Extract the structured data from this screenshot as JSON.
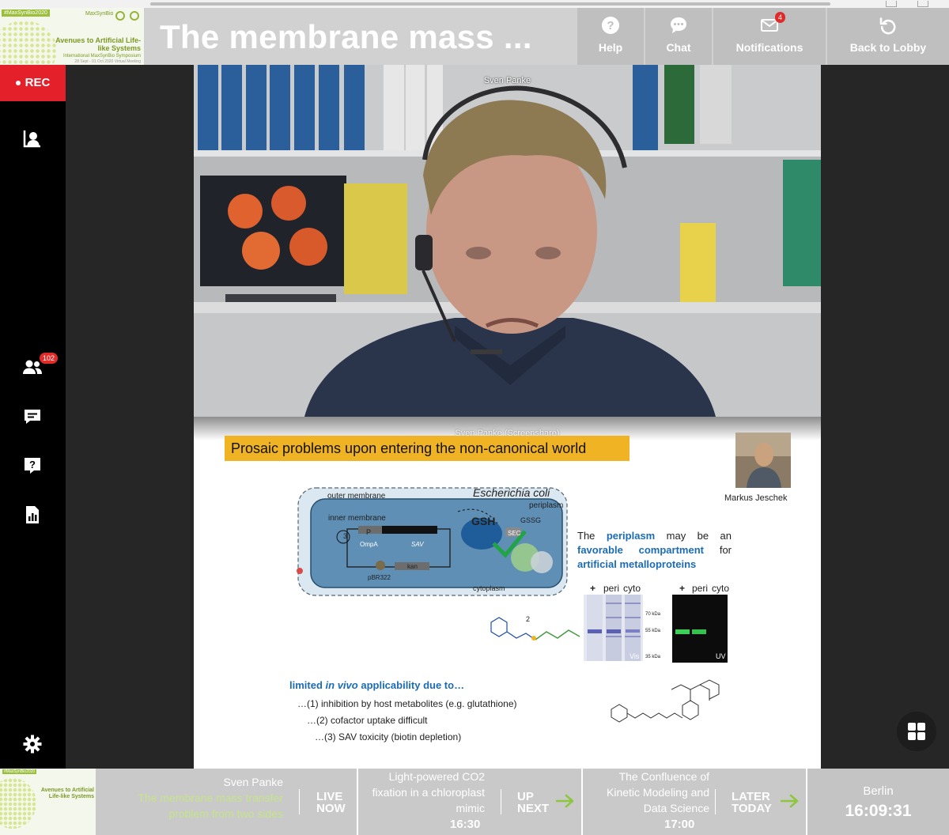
{
  "event": {
    "tag": "#MaxSynBio2020",
    "name": "Avenues to Artificial Life-like Systems",
    "subtitle": "International MaxSynBio Symposium",
    "dates": "28 Sept - 01 Oct 2020 Virtual Meeting",
    "brand": "MaxSynBio"
  },
  "header": {
    "session_title": "The membrane mass ...",
    "help_label": "Help",
    "chat_label": "Chat",
    "notifications_label": "Notifications",
    "notifications_count": "4",
    "back_label": "Back to Lobby"
  },
  "sidebar": {
    "rec_label": "REC",
    "participants_count": "102"
  },
  "video": {
    "speaker_name": "Sven Panke",
    "screenshare_name": "Sven Panke (Screenshare)"
  },
  "slide": {
    "title": "Prosaic problems upon entering the non-canonical world",
    "author": "Markus Jeschek",
    "organism": "Escherichia coli",
    "outer_membrane": "outer membrane",
    "periplasm": "periplasm",
    "inner_membrane": "inner membrane",
    "cytoplasm": "cytoplasm",
    "gsh": "GSH",
    "gssg": "GSSG",
    "sec": "SEC",
    "p_label": "P",
    "ompa": "OmpA",
    "sav": "SAV",
    "kan": "kan",
    "pbr": "pBR322",
    "step3": "3",
    "step2": "2",
    "fav_1": "The",
    "fav_2": "periplasm",
    "fav_3": "may be an",
    "fav_4": "favorable compartment",
    "fav_5": "for",
    "fav_6": "artificial metalloproteins",
    "gel_plus": "+",
    "gel_peri": "peri",
    "gel_cyto": "cyto",
    "kda70": "70 kDa",
    "kda55": "55 kDa",
    "kda35": "35 kDa",
    "vis": "Vis",
    "uv": "UV",
    "limited_1": "limited",
    "limited_2": "in vivo",
    "limited_3": "applicability due to…",
    "point_1": "…(1) inhibition by host metabolites (e.g. glutathione)",
    "point_2": "…(2) cofactor uptake difficult",
    "point_3": "…(3) SAV toxicity (biotin depletion)"
  },
  "schedule": {
    "current_speaker": "Sven Panke",
    "current_title": "The membrane mass transfer problem from two sides",
    "live_label_1": "LIVE",
    "live_label_2": "NOW",
    "next_title": "Light-powered CO2 fixation in a chloroplast mimic",
    "next_time": "16:30",
    "next_label_1": "UP",
    "next_label_2": "NEXT",
    "later_title": "The Confluence of Kinetic Modeling and Data Science",
    "later_time": "17:00",
    "later_label_1": "LATER",
    "later_label_2": "TODAY",
    "city": "Berlin",
    "clock": "16:09:31"
  },
  "colors": {
    "rec_red": "#e4212b",
    "accent_green": "#c6e48b",
    "arrow_green": "#8ec63f",
    "slide_title_bg": "#f0b323",
    "slide_blue": "#1c6cb3"
  }
}
